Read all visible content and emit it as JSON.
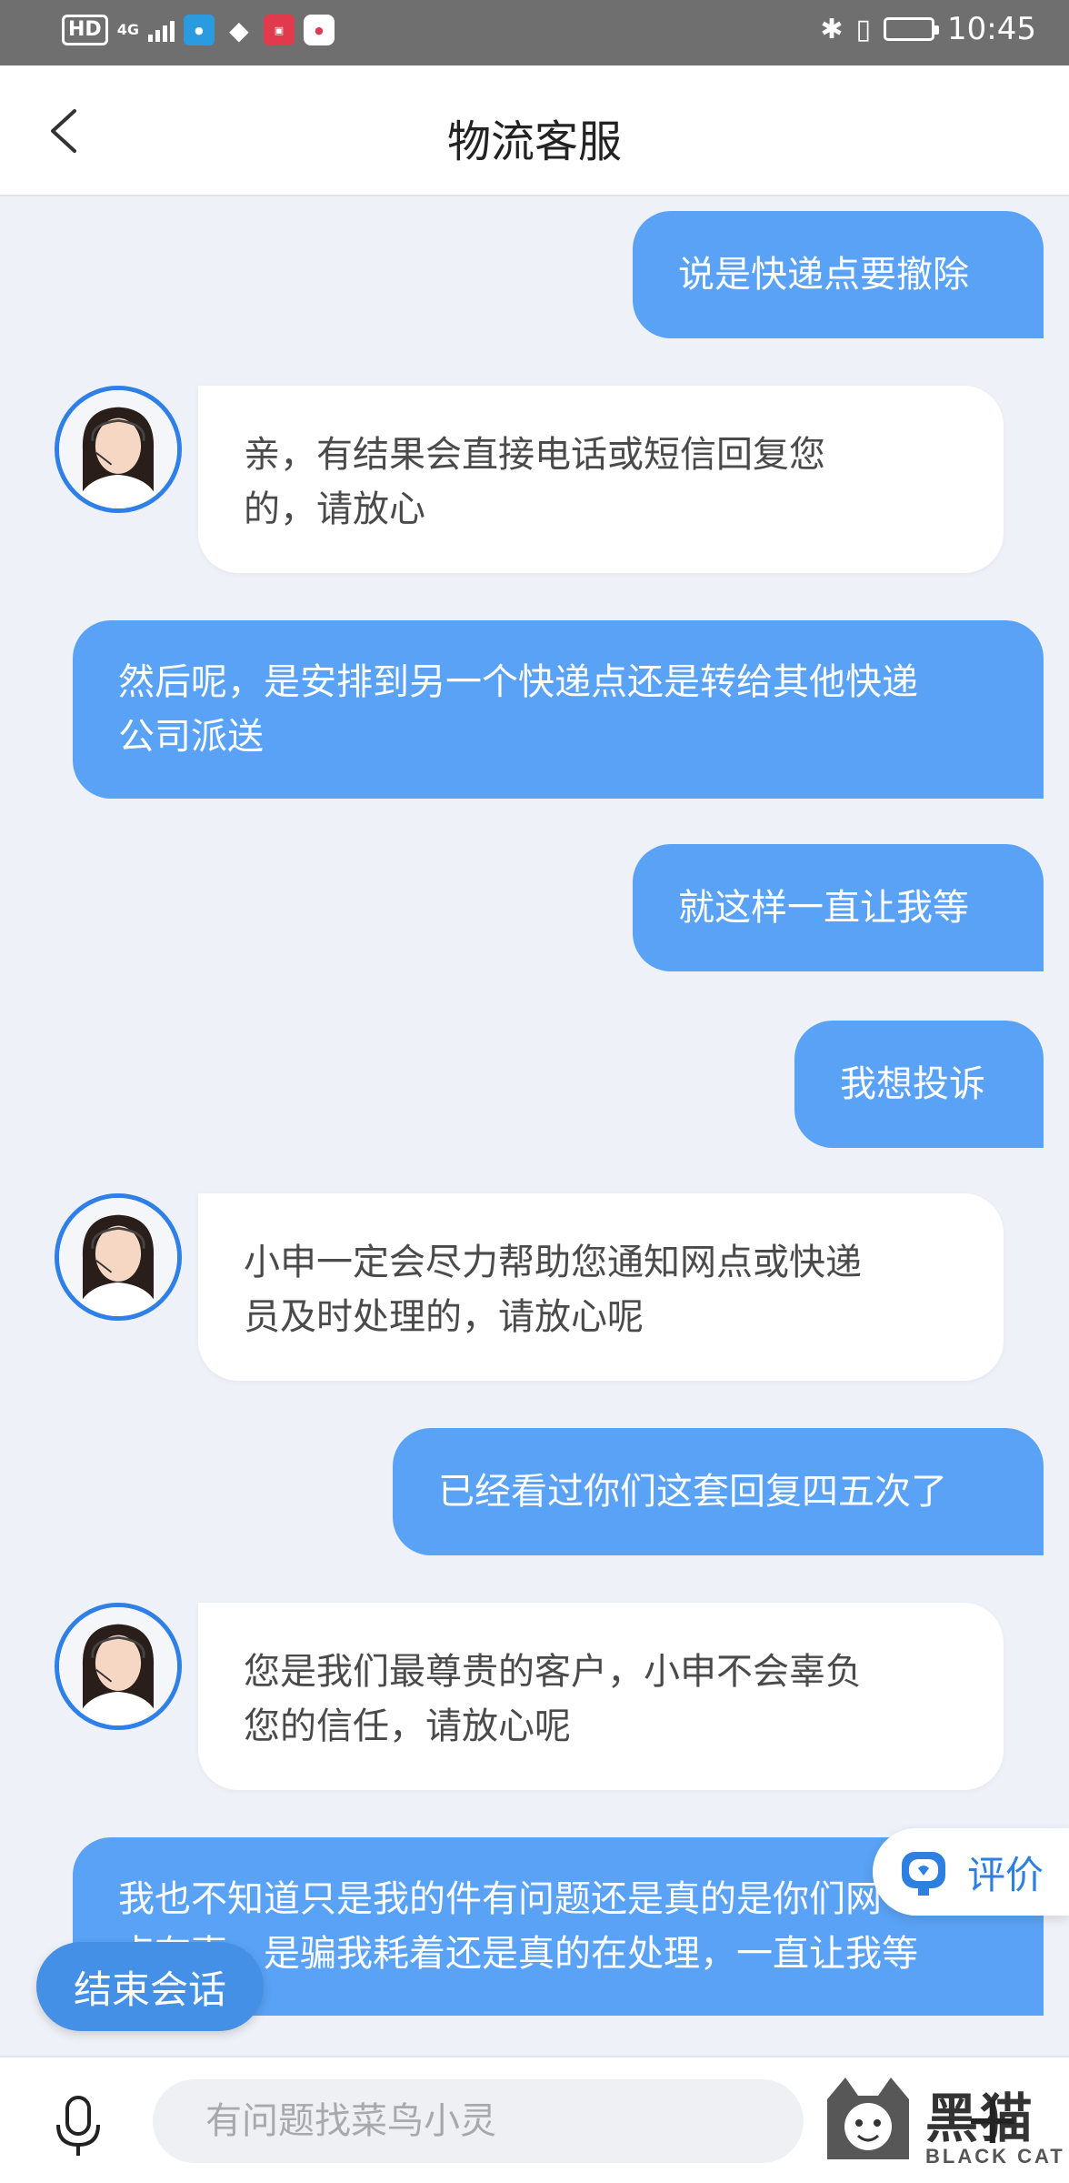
{
  "status_bar": {
    "hd": "HD",
    "network": "4G",
    "time": "10:45",
    "app_icons": [
      "browser-icon",
      "qq-icon",
      "shopping-icon",
      "map-icon"
    ]
  },
  "header": {
    "title": "物流客服"
  },
  "messages": [
    {
      "sender": "user",
      "lines": [
        "说是快递点要撤除"
      ]
    },
    {
      "sender": "agent",
      "lines": [
        "亲，有结果会直接电话或短信回复您",
        "的，请放心"
      ]
    },
    {
      "sender": "user",
      "lines": [
        "然后呢，是安排到另一个快递点还是转给其他快递",
        "公司派送"
      ]
    },
    {
      "sender": "user",
      "lines": [
        "就这样一直让我等"
      ]
    },
    {
      "sender": "user",
      "lines": [
        "我想投诉"
      ]
    },
    {
      "sender": "agent",
      "lines": [
        "小申一定会尽力帮助您通知网点或快递",
        "员及时处理的，请放心呢"
      ]
    },
    {
      "sender": "user",
      "lines": [
        "已经看过你们这套回复四五次了"
      ]
    },
    {
      "sender": "agent",
      "lines": [
        "您是我们最尊贵的客户，小申不会辜负",
        "您的信任，请放心呢"
      ]
    },
    {
      "sender": "user",
      "lines": [
        "我也不知道只是我的件有问题还是真的是你们网",
        "点有事，是骗我耗着还是真的在处理，一直让我等"
      ]
    }
  ],
  "floating": {
    "rate_label": "评价",
    "end_label": "结束会话"
  },
  "input_bar": {
    "placeholder": "有问题找菜鸟小灵",
    "plus": "+"
  },
  "watermark": {
    "text": "黑猫",
    "subtext": "BLACK CAT"
  },
  "colors": {
    "user_bubble": "#5aa2f5",
    "avatar_ring": "#2f7fe8",
    "rate_text": "#2d7fe0",
    "end_button": "#4490e6",
    "background": "#eef1f7"
  }
}
